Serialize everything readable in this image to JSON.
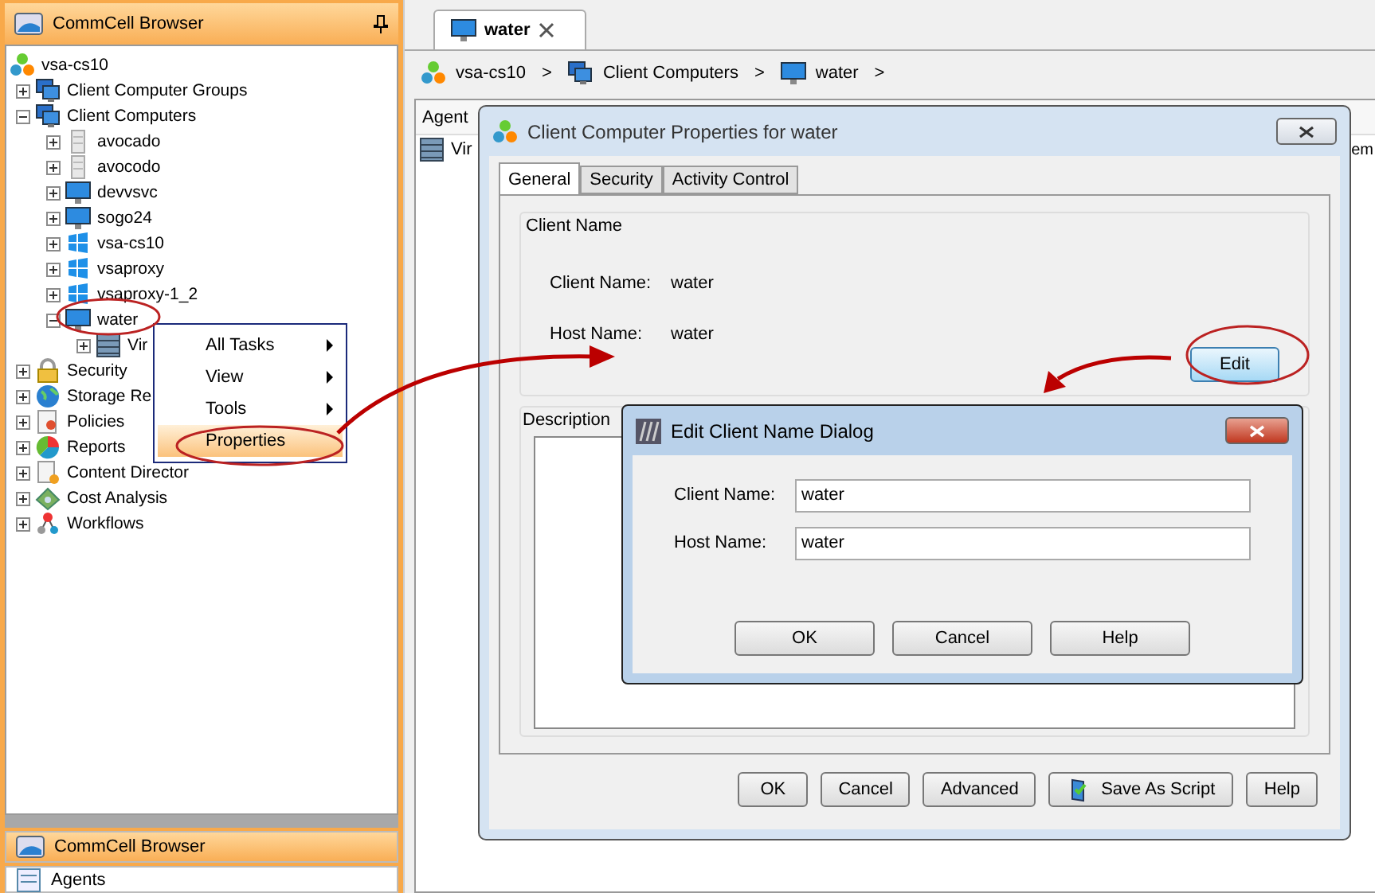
{
  "sidebar": {
    "title": "CommCell Browser",
    "tree": [
      {
        "label": "vsa-cs10",
        "kind": "root",
        "children": [
          {
            "label": "Client Computer Groups",
            "kind": "group",
            "expanded": false
          },
          {
            "label": "Client Computers",
            "kind": "group",
            "expanded": true,
            "children": [
              {
                "label": "avocado",
                "kind": "server",
                "expanded": false
              },
              {
                "label": "avocodo",
                "kind": "server",
                "expanded": false
              },
              {
                "label": "devvsvc",
                "kind": "monitor",
                "expanded": false
              },
              {
                "label": "sogo24",
                "kind": "monitor",
                "expanded": false
              },
              {
                "label": "vsa-cs10",
                "kind": "windows",
                "expanded": false
              },
              {
                "label": "vsaproxy",
                "kind": "windows",
                "expanded": false
              },
              {
                "label": "vsaproxy-1_2",
                "kind": "windows",
                "expanded": false
              },
              {
                "label": "water",
                "kind": "monitor",
                "expanded": true,
                "children": [
                  {
                    "label": "Vir",
                    "kind": "rack",
                    "expanded": false
                  }
                ]
              }
            ]
          },
          {
            "label": "Security",
            "kind": "lock",
            "expanded": false
          },
          {
            "label": "Storage Re",
            "kind": "globe",
            "expanded": false
          },
          {
            "label": "Policies",
            "kind": "policy",
            "expanded": false
          },
          {
            "label": "Reports",
            "kind": "reports",
            "expanded": false
          },
          {
            "label": "Content Director",
            "kind": "document",
            "expanded": false
          },
          {
            "label": "Cost Analysis",
            "kind": "money",
            "expanded": false
          },
          {
            "label": "Workflows",
            "kind": "workflow",
            "expanded": false
          }
        ]
      }
    ],
    "bottom_tabs": [
      {
        "label": "CommCell Browser",
        "selected": true
      },
      {
        "label": "Agents",
        "selected": false
      }
    ]
  },
  "tab": {
    "label": "water"
  },
  "breadcrumb": {
    "separator": ">",
    "items": [
      {
        "label": "vsa-cs10",
        "kind": "root"
      },
      {
        "label": "Client Computers",
        "kind": "group"
      },
      {
        "label": "water",
        "kind": "monitor"
      }
    ]
  },
  "background_list": {
    "column_1": "Agent",
    "row_1": "Vir",
    "column_2": "em"
  },
  "context_menu": {
    "items": [
      {
        "label": "All Tasks",
        "submenu": true,
        "selected": false
      },
      {
        "label": "View",
        "submenu": true,
        "selected": false
      },
      {
        "label": "Tools",
        "submenu": true,
        "selected": false
      },
      {
        "label": "Properties",
        "submenu": false,
        "selected": true
      }
    ]
  },
  "properties_dialog": {
    "title": "Client Computer Properties for water",
    "tabs": [
      {
        "label": "General",
        "selected": true
      },
      {
        "label": "Security",
        "selected": false
      },
      {
        "label": "Activity Control",
        "selected": false
      }
    ],
    "group_title": "Client Name",
    "fields": [
      {
        "label": "Client Name:",
        "value": "water"
      },
      {
        "label": "Host Name:",
        "value": "water"
      }
    ],
    "edit_button": "Edit",
    "description_label": "Description",
    "buttons": [
      {
        "label": "OK",
        "kind": "plain"
      },
      {
        "label": "Cancel",
        "kind": "plain"
      },
      {
        "label": "Advanced",
        "kind": "plain"
      },
      {
        "label": "Save As Script",
        "kind": "script"
      },
      {
        "label": "Help",
        "kind": "plain"
      }
    ]
  },
  "edit_dialog": {
    "title": "Edit Client Name Dialog",
    "fields": [
      {
        "label": "Client Name:",
        "value": "water"
      },
      {
        "label": "Host Name:",
        "value": "water"
      }
    ],
    "buttons": [
      "OK",
      "Cancel",
      "Help"
    ]
  }
}
